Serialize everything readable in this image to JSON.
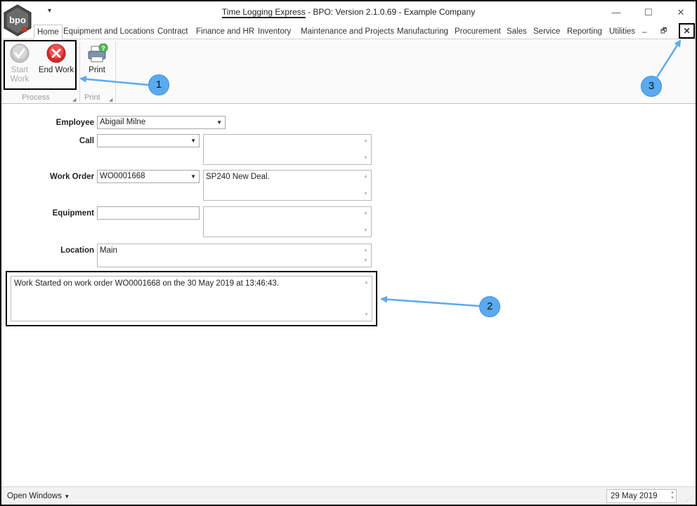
{
  "window": {
    "title_app": "Time Logging Express",
    "title_rest": " - BPO: Version 2.1.0.69 - Example Company",
    "logo_text": "bpo",
    "qat_arrow": "▾",
    "minimize": "—",
    "maximize": "☐",
    "close": "✕"
  },
  "menu": {
    "tabs": [
      {
        "label": "Home"
      },
      {
        "label": "Equipment and Locations"
      },
      {
        "label": "Contract"
      },
      {
        "label": "Finance and HR"
      },
      {
        "label": "Inventory"
      },
      {
        "label": "Maintenance and Projects"
      },
      {
        "label": "Manufacturing"
      },
      {
        "label": "Procurement"
      },
      {
        "label": "Sales"
      },
      {
        "label": "Service"
      },
      {
        "label": "Reporting"
      },
      {
        "label": "Utilities"
      }
    ],
    "mdi_minimize": "–",
    "mdi_restore": "🗗",
    "mdi_close": "✕"
  },
  "ribbon": {
    "start_work": {
      "label_line1": "Start",
      "label_line2": "Work",
      "enabled": false
    },
    "end_work": {
      "label": "End Work"
    },
    "print": {
      "label": "Print"
    },
    "groups": [
      {
        "label": "Process"
      },
      {
        "label": "Print"
      }
    ]
  },
  "form": {
    "employee": {
      "label": "Employee",
      "value": "Abigail Milne"
    },
    "call": {
      "label": "Call",
      "value": "",
      "description": ""
    },
    "work_order": {
      "label": "Work Order",
      "value": "WO0001668",
      "description": "SP240 New Deal."
    },
    "equipment": {
      "label": "Equipment",
      "value": "",
      "description": ""
    },
    "location": {
      "label": "Location",
      "value": "Main"
    },
    "status_message": "Work Started on work order WO0001668 on the 30 May 2019 at 13:46:43."
  },
  "callouts": [
    "1",
    "2",
    "3"
  ],
  "statusbar": {
    "open_windows": "Open Windows",
    "date": "29 May 2019"
  },
  "colors": {
    "callout_fill": "#5aaaf0",
    "end_work_red": "#e03030",
    "start_work_gray": "#b9b9b9"
  }
}
